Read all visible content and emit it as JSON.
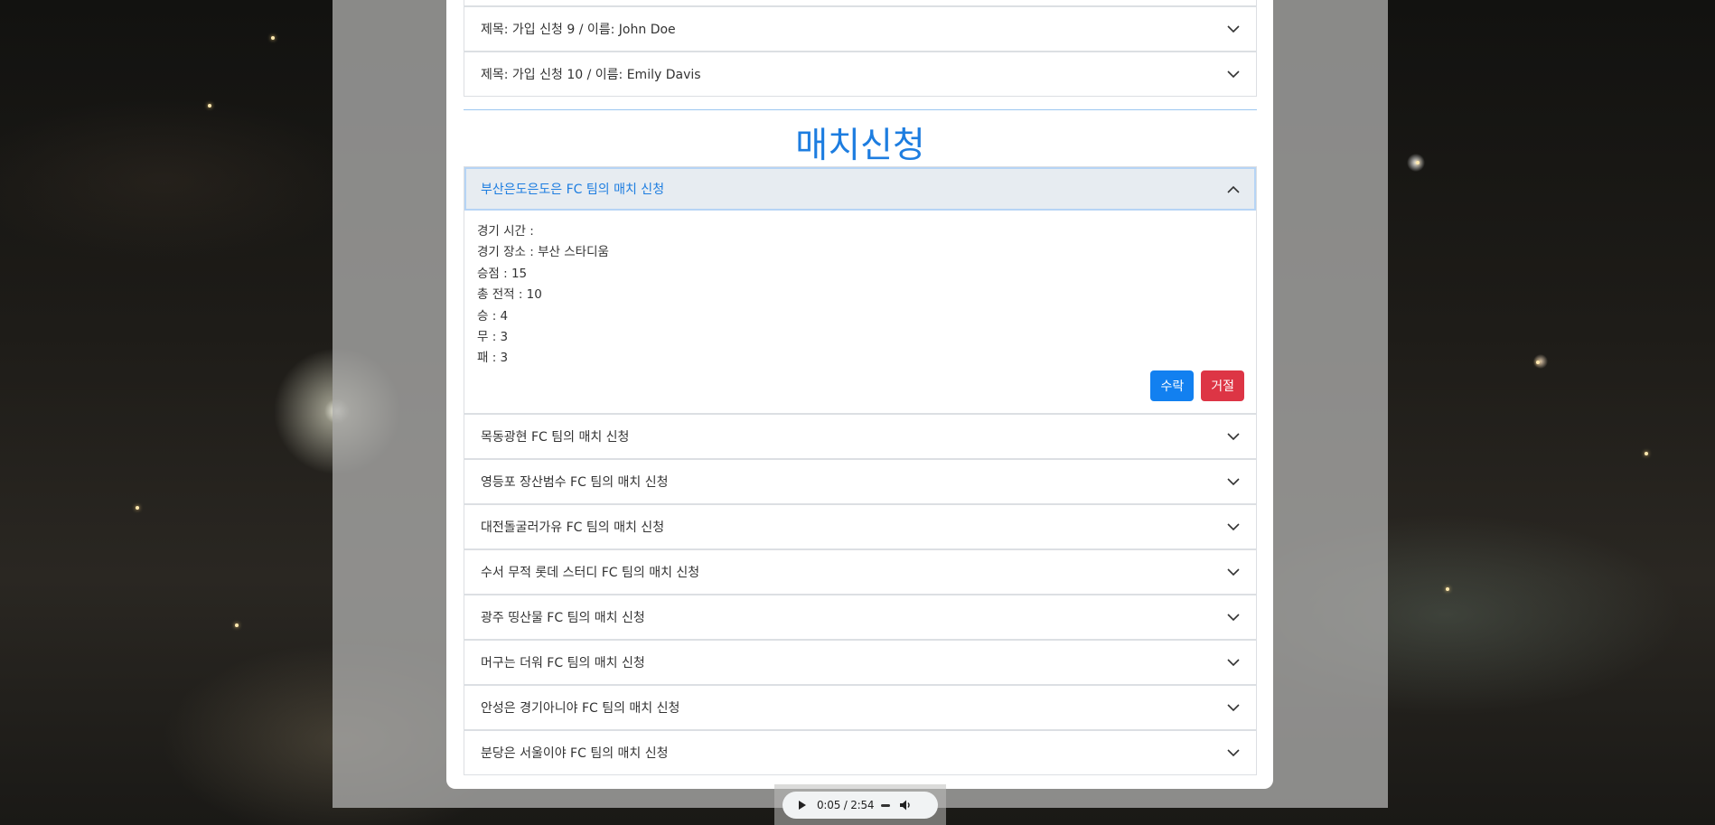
{
  "signup_items": [
    {
      "label": "제목: 가입 신청 9 / 이름: John Doe"
    },
    {
      "label": "제목: 가입 신청 10 / 이름: Emily Davis"
    }
  ],
  "match_section": {
    "title": "매치신청",
    "open_item": {
      "label": "부산은도은도은 FC 팀의 매치 신청",
      "details": [
        "경기 시간 :",
        "경기 장소 : 부산 스타디움",
        "승점 : 15",
        "총 전적 : 10",
        "승 : 4",
        "무 : 3",
        "패 : 3"
      ],
      "accept_label": "수락",
      "reject_label": "거절"
    },
    "items": [
      {
        "label": "목동광현 FC 팀의 매치 신청"
      },
      {
        "label": "영등포 장산범수 FC 팀의 매치 신청"
      },
      {
        "label": "대전돌굴러가유 FC 팀의 매치 신청"
      },
      {
        "label": "수서 무적 롯데 스터디 FC 팀의 매치 신청"
      },
      {
        "label": "광주 띵산물 FC 팀의 매치 신청"
      },
      {
        "label": "머구는 더워 FC 팀의 매치 신청"
      },
      {
        "label": "안성은 경기아니야 FC 팀의 매치 신청"
      },
      {
        "label": "분당은 서울이야 FC 팀의 매치 신청"
      }
    ]
  },
  "audio_player": {
    "time": "0:05 / 2:54"
  },
  "colors": {
    "accent": "#1d7de0",
    "accept": "#1280f0",
    "reject": "#dd3545"
  }
}
